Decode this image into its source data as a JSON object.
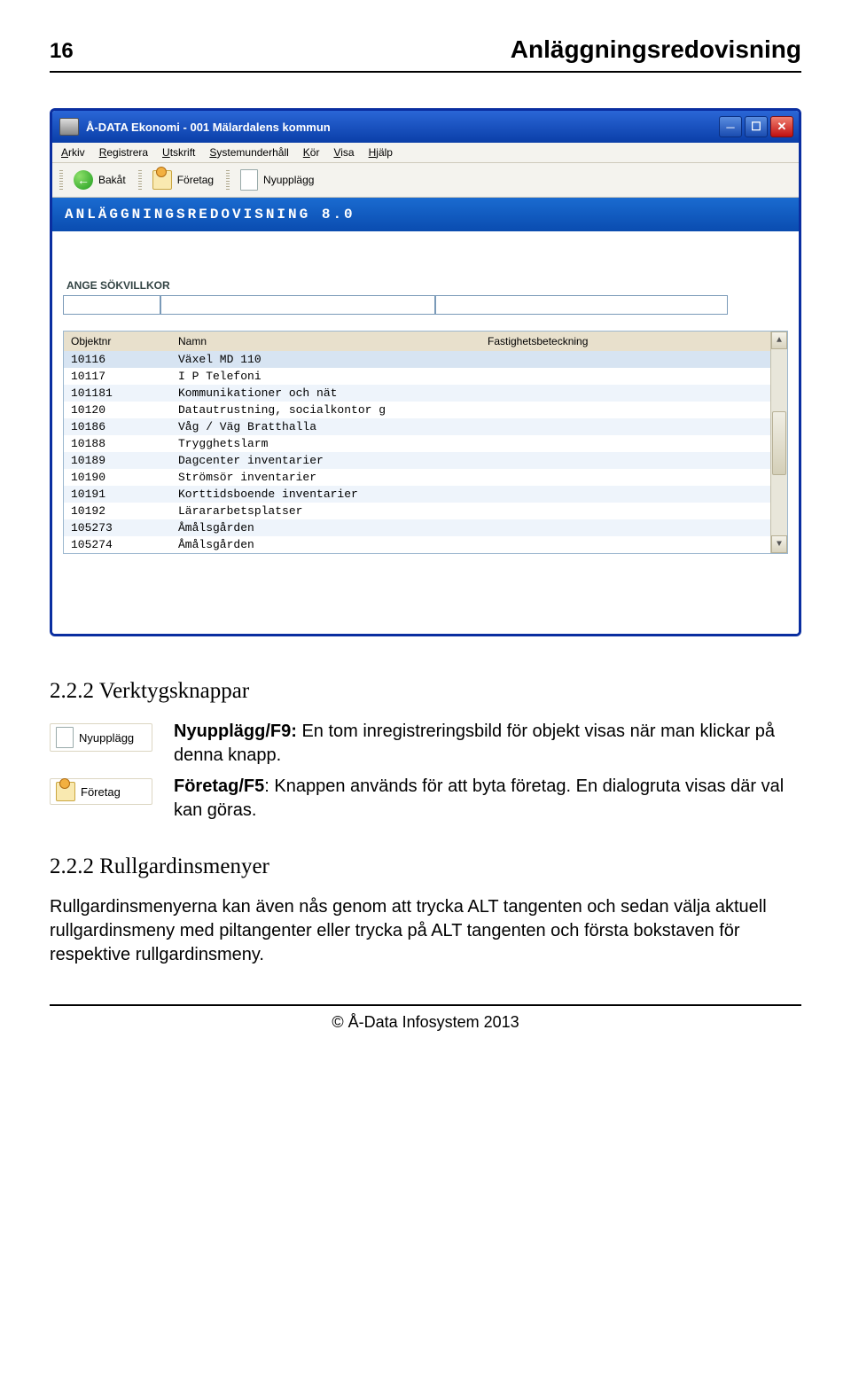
{
  "page_number": "16",
  "document_title": "Anläggningsredovisning",
  "screenshot": {
    "window_title": "Å-DATA Ekonomi  -  001 Mälardalens kommun",
    "menus": [
      "Arkiv",
      "Registrera",
      "Utskrift",
      "Systemunderhåll",
      "Kör",
      "Visa",
      "Hjälp"
    ],
    "toolbar": {
      "back": "Bakåt",
      "company": "Företag",
      "new": "Nyupplägg"
    },
    "bluebar": "ANLÄGGNINGSREDOVISNING 8.0",
    "search_label": "ANGE SÖKVILLKOR",
    "columns": {
      "c1": "Objektnr",
      "c2": "Namn",
      "c3": "Fastighetsbeteckning"
    },
    "rows": [
      {
        "c1": "10116",
        "c2": "Växel MD 110",
        "c3": ""
      },
      {
        "c1": "10117",
        "c2": "I P Telefoni",
        "c3": ""
      },
      {
        "c1": "101181",
        "c2": "Kommunikationer och nät",
        "c3": ""
      },
      {
        "c1": "10120",
        "c2": "Datautrustning, socialkontor g",
        "c3": ""
      },
      {
        "c1": "10186",
        "c2": "Våg / Väg Bratthalla",
        "c3": ""
      },
      {
        "c1": "10188",
        "c2": "Trygghetslarm",
        "c3": ""
      },
      {
        "c1": "10189",
        "c2": "Dagcenter inventarier",
        "c3": ""
      },
      {
        "c1": "10190",
        "c2": "Strömsör inventarier",
        "c3": ""
      },
      {
        "c1": "10191",
        "c2": "Korttidsboende inventarier",
        "c3": ""
      },
      {
        "c1": "10192",
        "c2": "Lärararbetsplatser",
        "c3": ""
      },
      {
        "c1": "105273",
        "c2": "Åmålsgården",
        "c3": ""
      },
      {
        "c1": "105274",
        "c2": "Åmålsgården",
        "c3": ""
      }
    ]
  },
  "section_1": {
    "heading": "2.2.2 Verktygsknappar",
    "icons": {
      "new_label": "Nyupplägg",
      "company_label": "Företag"
    },
    "p1_strong": "Nyupplägg/F9:",
    "p1_rest": " En tom inregistreringsbild för objekt visas när man klickar på denna knapp.",
    "p2_strong": "Företag/F5",
    "p2_rest": ": Knappen används för att byta företag. En dialogruta visas där val kan göras."
  },
  "section_2": {
    "heading": "2.2.2 Rullgardinsmenyer",
    "p": "Rullgardinsmenyerna kan även nås genom att trycka ALT tangenten och sedan välja aktuell rullgardinsmeny med piltangenter eller trycka på ALT tangenten och första bokstaven för respektive rullgardinsmeny."
  },
  "footer": "© Å-Data Infosystem 2013"
}
